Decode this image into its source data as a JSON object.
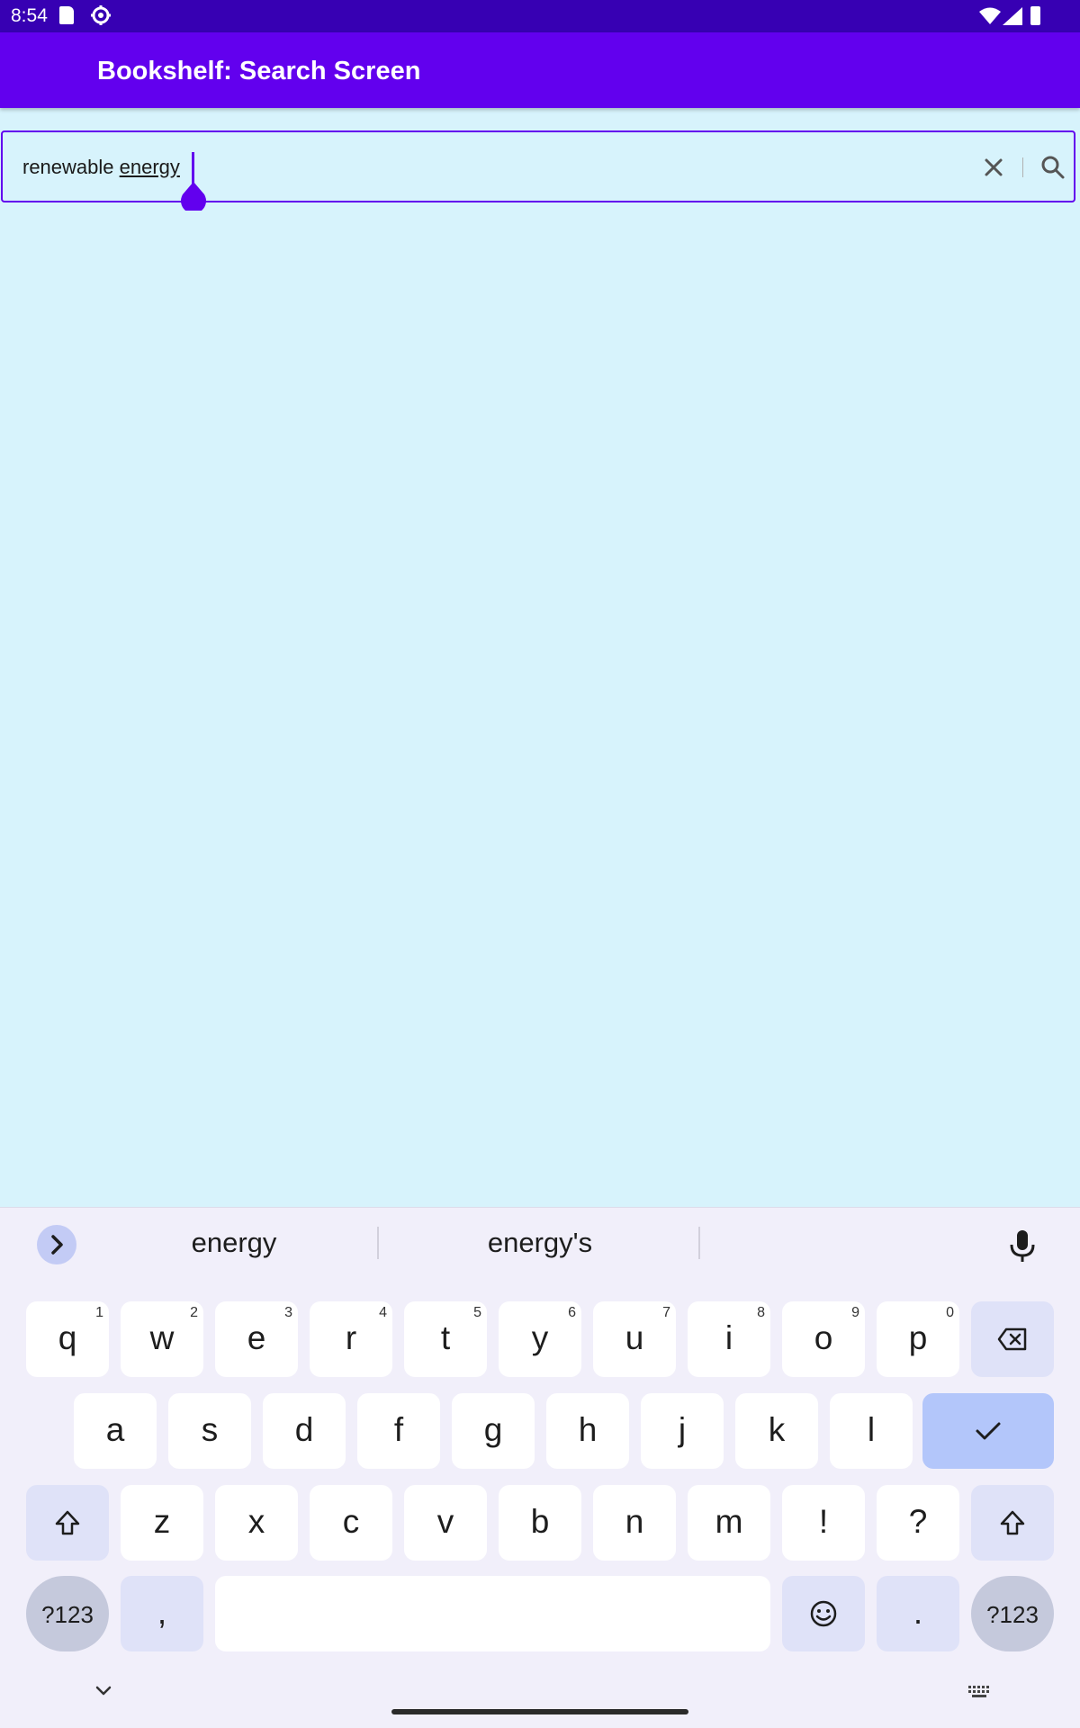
{
  "status_bar": {
    "time": "8:54"
  },
  "app_bar": {
    "title": "Bookshelf: Search Screen"
  },
  "search": {
    "text_plain": "renewable ",
    "text_composing": "energy"
  },
  "keyboard": {
    "suggestions": [
      "energy",
      "energy's"
    ],
    "row1": [
      {
        "k": "q",
        "h": "1"
      },
      {
        "k": "w",
        "h": "2"
      },
      {
        "k": "e",
        "h": "3"
      },
      {
        "k": "r",
        "h": "4"
      },
      {
        "k": "t",
        "h": "5"
      },
      {
        "k": "y",
        "h": "6"
      },
      {
        "k": "u",
        "h": "7"
      },
      {
        "k": "i",
        "h": "8"
      },
      {
        "k": "o",
        "h": "9"
      },
      {
        "k": "p",
        "h": "0"
      }
    ],
    "row2": [
      "a",
      "s",
      "d",
      "f",
      "g",
      "h",
      "j",
      "k",
      "l"
    ],
    "row3": [
      "z",
      "x",
      "c",
      "v",
      "b",
      "n",
      "m",
      "!",
      "?"
    ],
    "symbols_label": "?123",
    "comma": ",",
    "period": "."
  },
  "colors": {
    "primary": "#6200ee",
    "status_bar": "#3700b3",
    "background": "#d7f3fc"
  }
}
